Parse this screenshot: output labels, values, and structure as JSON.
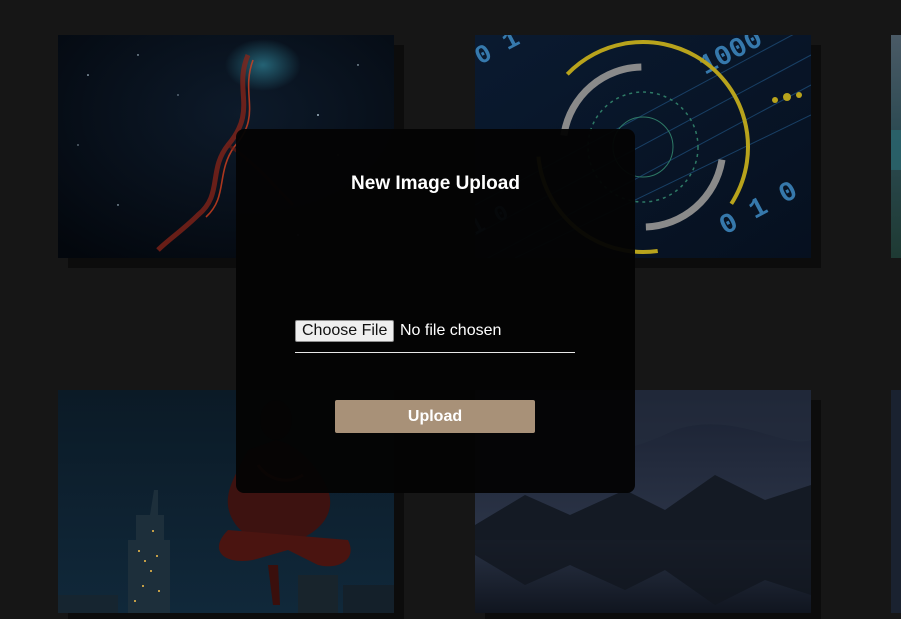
{
  "modal": {
    "title": "New Image Upload",
    "choose_file_label": "Choose File",
    "file_status": "No file chosen",
    "upload_label": "Upload"
  },
  "gallery": {
    "images": [
      {
        "subject": "nebula"
      },
      {
        "subject": "binary-code-circuit"
      },
      {
        "subject": "landscape-edge"
      },
      {
        "subject": "spider-hero-city"
      },
      {
        "subject": "mountain-lake-night"
      },
      {
        "subject": "dark-edge"
      }
    ]
  },
  "colors": {
    "background": "#161616",
    "modal": "#040404",
    "upload_button": "#a89178"
  }
}
